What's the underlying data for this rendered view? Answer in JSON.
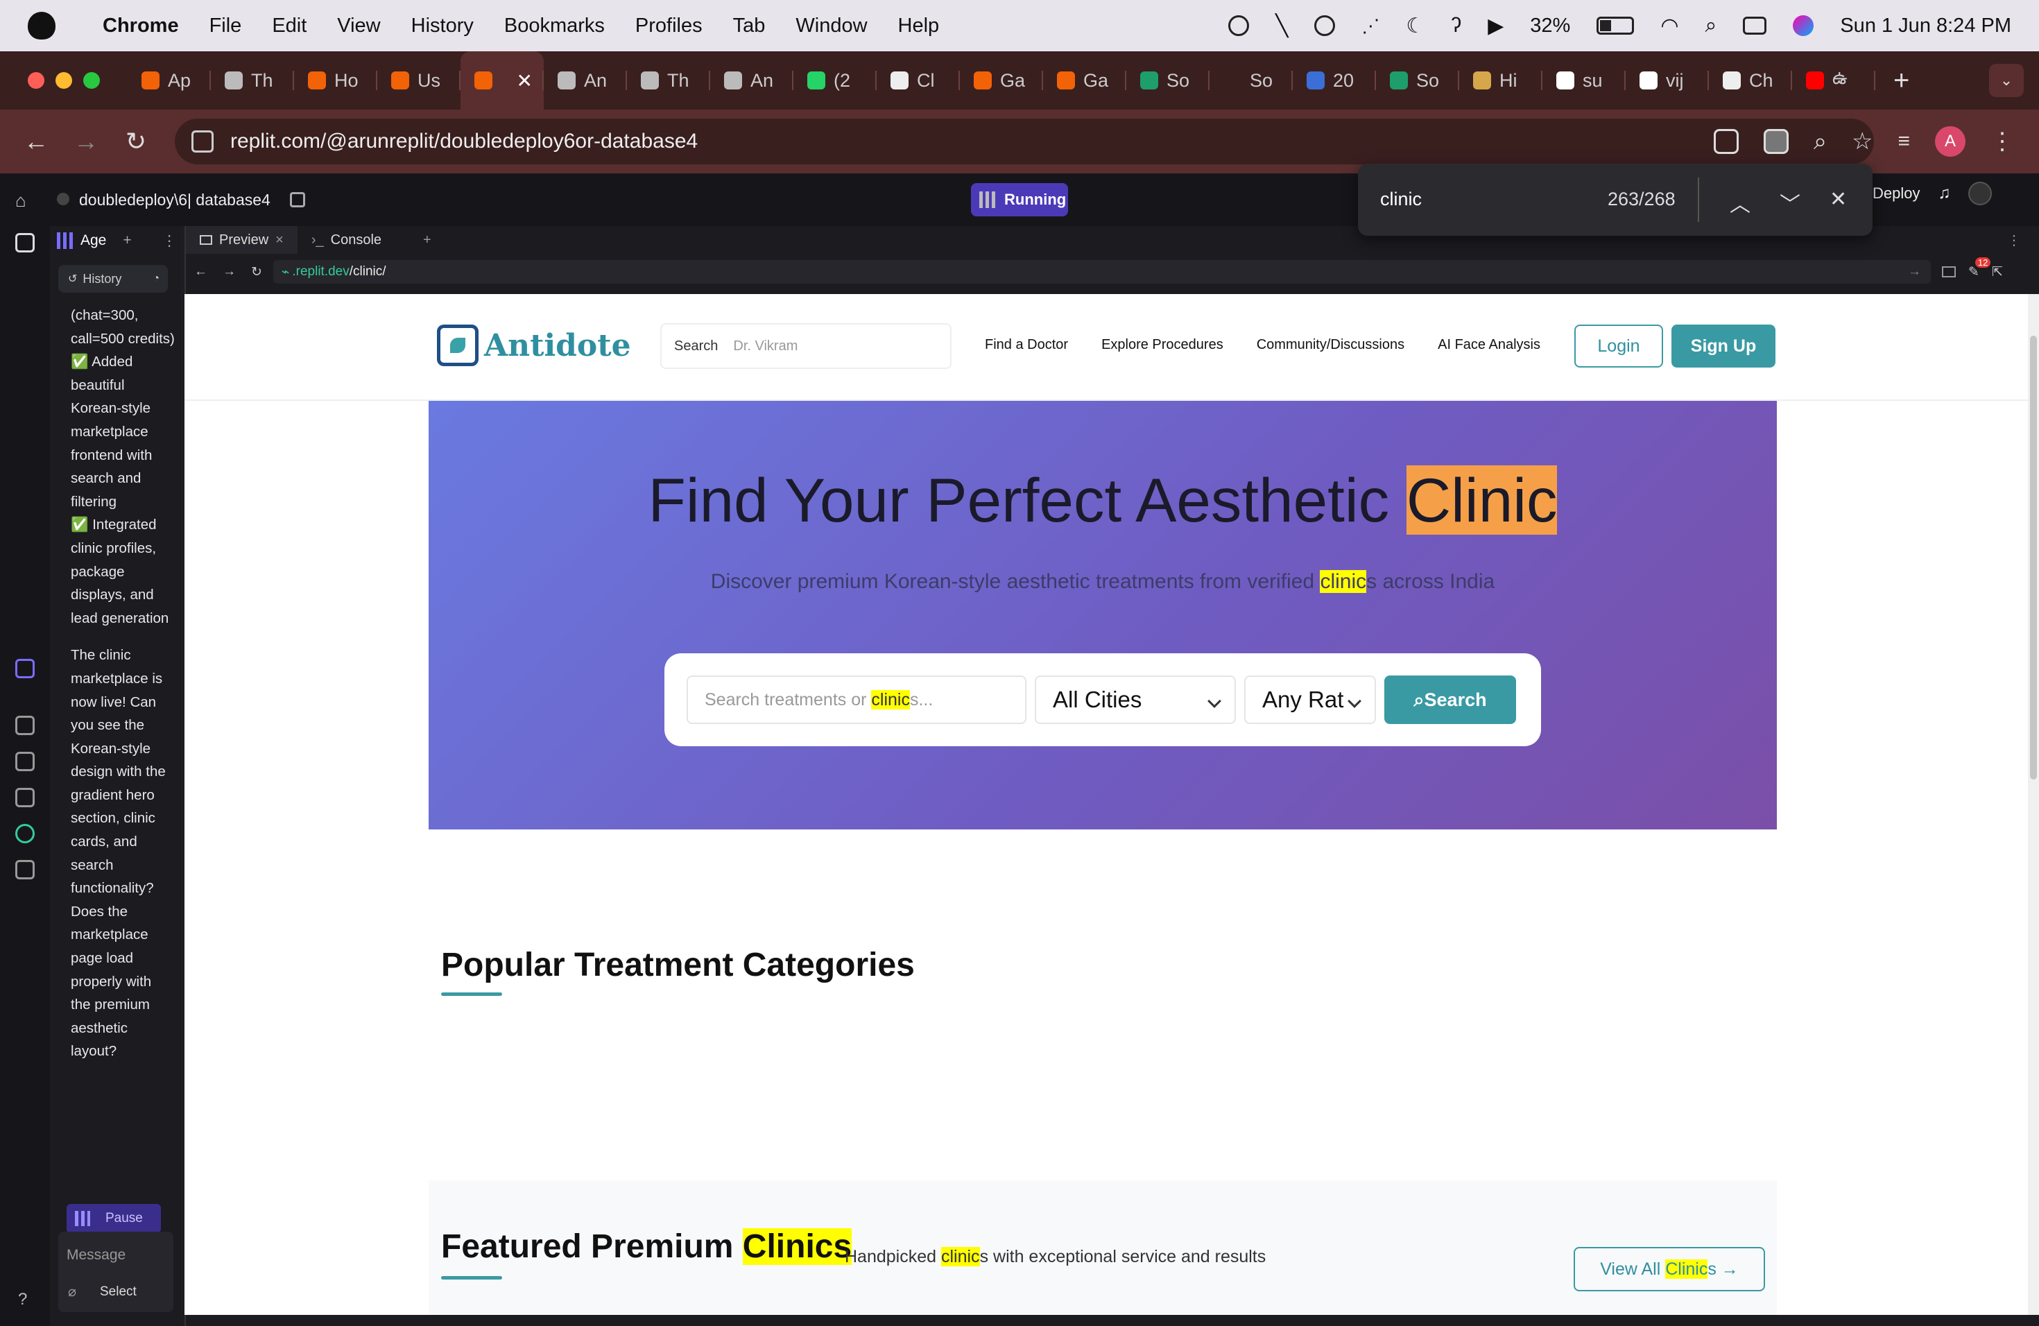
{
  "menubar": {
    "app_name": "Chrome",
    "items": [
      "File",
      "Edit",
      "View",
      "History",
      "Bookmarks",
      "Profiles",
      "Tab",
      "Window",
      "Help"
    ],
    "battery": "32%",
    "datetime": "Sun 1 Jun  8:24 PM"
  },
  "tabs": [
    {
      "label": "Ap",
      "icon": "replit-icon",
      "color": "#f26207"
    },
    {
      "label": "Th",
      "icon": "globe-icon",
      "color": "#bbbbbb"
    },
    {
      "label": "Ho",
      "icon": "replit-icon",
      "color": "#f26207"
    },
    {
      "label": "Us",
      "icon": "replit-icon",
      "color": "#f26207"
    },
    {
      "label": "",
      "icon": "replit-icon",
      "color": "#f26207",
      "active": true
    },
    {
      "label": "An",
      "icon": "globe-icon",
      "color": "#bbbbbb"
    },
    {
      "label": "Th",
      "icon": "globe-icon",
      "color": "#bbbbbb"
    },
    {
      "label": "An",
      "icon": "globe-icon",
      "color": "#bbbbbb"
    },
    {
      "label": "(2",
      "icon": "whatsapp-icon",
      "color": "#25d366"
    },
    {
      "label": "Cl",
      "icon": "openai-icon",
      "color": "#eeeeee"
    },
    {
      "label": "Ga",
      "icon": "shield-icon",
      "color": "#f26207"
    },
    {
      "label": "Ga",
      "icon": "shield-icon",
      "color": "#f26207"
    },
    {
      "label": "So",
      "icon": "app-icon",
      "color": "#1e9e6a"
    },
    {
      "label": "So",
      "icon": "blank-icon",
      "color": "#3a1f1f"
    },
    {
      "label": "20",
      "icon": "chart-icon",
      "color": "#3b6fd8"
    },
    {
      "label": "So",
      "icon": "app-icon",
      "color": "#1e9e6a"
    },
    {
      "label": "Hi",
      "icon": "image-icon",
      "color": "#d6a64a"
    },
    {
      "label": "su",
      "icon": "google-icon",
      "color": "#ffffff"
    },
    {
      "label": "vij",
      "icon": "google-icon",
      "color": "#ffffff"
    },
    {
      "label": "Ch",
      "icon": "openai-icon",
      "color": "#eeeeee"
    },
    {
      "label": "ఉ",
      "icon": "youtube-icon",
      "color": "#ff0000"
    }
  ],
  "address": {
    "url": "replit.com/@arunreplit/doubledeploy6or-database4",
    "avatar": "A"
  },
  "replit": {
    "project": "doubledeploy\\6| database4",
    "status": "Running",
    "deploy": "Deploy",
    "agent_tab": "Age",
    "history": "History",
    "chat": [
      "(chat=300, call=500 credits)",
      "✅ Added beautiful Korean-style marketplace frontend with search and filtering",
      "✅ Integrated clinic profiles, package displays, and lead generation",
      "The clinic marketplace is now live! Can you see the Korean-style design with the gradient hero section, clinic cards, and search functionality? Does the marketplace page load properly with the premium aesthetic layout?"
    ],
    "pause": "Pause",
    "message_placeholder": "Message",
    "select": "Select",
    "preview_tab": "Preview",
    "console_tab": "Console",
    "preview_url_host": ".replit.dev",
    "preview_url_path": "/clinic/",
    "badge": "12"
  },
  "find": {
    "query": "clinic",
    "count": "263/268"
  },
  "site": {
    "logo": "Antidote",
    "search_label": "Search",
    "search_placeholder": "Dr. Vikram",
    "nav": [
      "Find a Doctor",
      "Explore Procedures",
      "Community/Discussions",
      "AI Face Analysis"
    ],
    "login": "Login",
    "signup": "Sign Up",
    "hero_title_pre": "Find Your Perfect Aesthetic ",
    "hero_title_hl": "Clinic",
    "hero_sub_pre": "Discover premium Korean-style aesthetic treatments from verified ",
    "hero_sub_hl": "clinic",
    "hero_sub_post": "s across India",
    "search_ph_pre": "Search treatments or ",
    "search_ph_hl": "clinic",
    "search_ph_post": "s...",
    "city_select": "All Cities",
    "rating_select": "Any Rat",
    "search_button": "Search",
    "popular_title": "Popular Treatment Categories",
    "featured_title_pre": "Featured Premium ",
    "featured_title_hl": "Clinics",
    "featured_sub_pre": "Handpicked ",
    "featured_sub_hl": "clinic",
    "featured_sub_post": "s with exceptional service and results",
    "view_all_pre": "View All ",
    "view_all_hl": "Clinic",
    "view_all_post": "s"
  }
}
